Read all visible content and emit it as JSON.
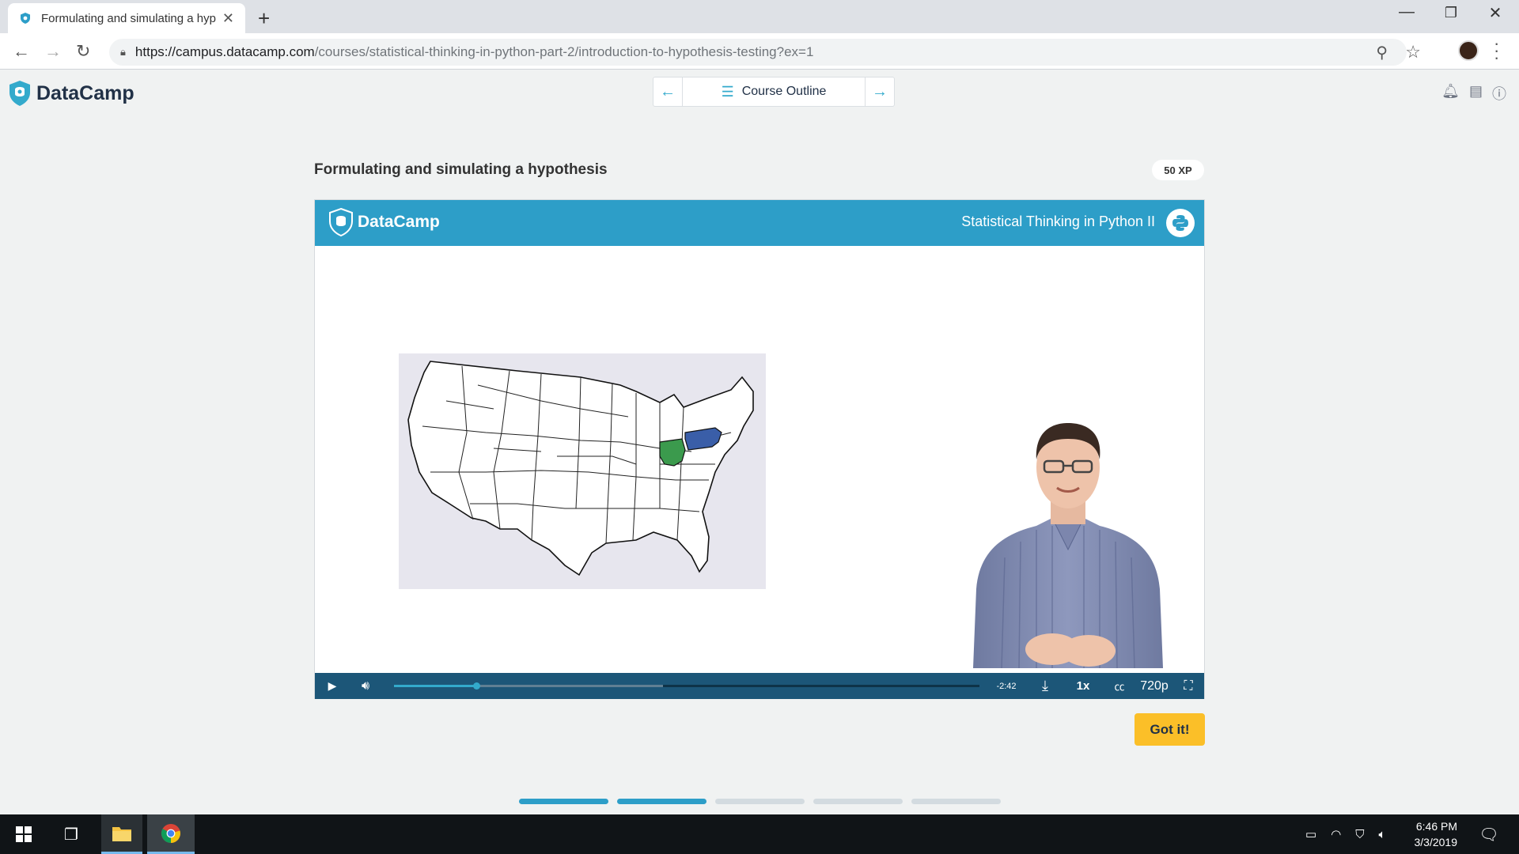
{
  "browser": {
    "tab_title": "Formulating and simulating a hyp",
    "url_host": "https://campus.datacamp.com",
    "url_path": "/courses/statistical-thinking-in-python-part-2/introduction-to-hypothesis-testing?ex=1"
  },
  "header": {
    "logo_text": "DataCamp",
    "outline_label": "Course Outline"
  },
  "exercise": {
    "title": "Formulating and simulating a hypothesis",
    "xp": "50 XP",
    "got_it": "Got it!"
  },
  "video": {
    "brand": "DataCamp",
    "course_title": "Statistical Thinking in Python II",
    "time_remaining": "-2:42",
    "speed": "1x",
    "quality": "720p",
    "played_fraction": 0.14,
    "buffered_fraction": 0.46
  },
  "steps": {
    "total": 5,
    "completed": 2
  },
  "taskbar": {
    "time": "6:46 PM",
    "date": "3/3/2019"
  },
  "colors": {
    "brand_blue": "#2d9ec8",
    "accent": "#33aacc",
    "got_it_yellow": "#fbbf28",
    "control_bar": "#1c5678",
    "ohio_green": "#3b9a4d",
    "pennsylvania_blue": "#3a5ea8"
  }
}
